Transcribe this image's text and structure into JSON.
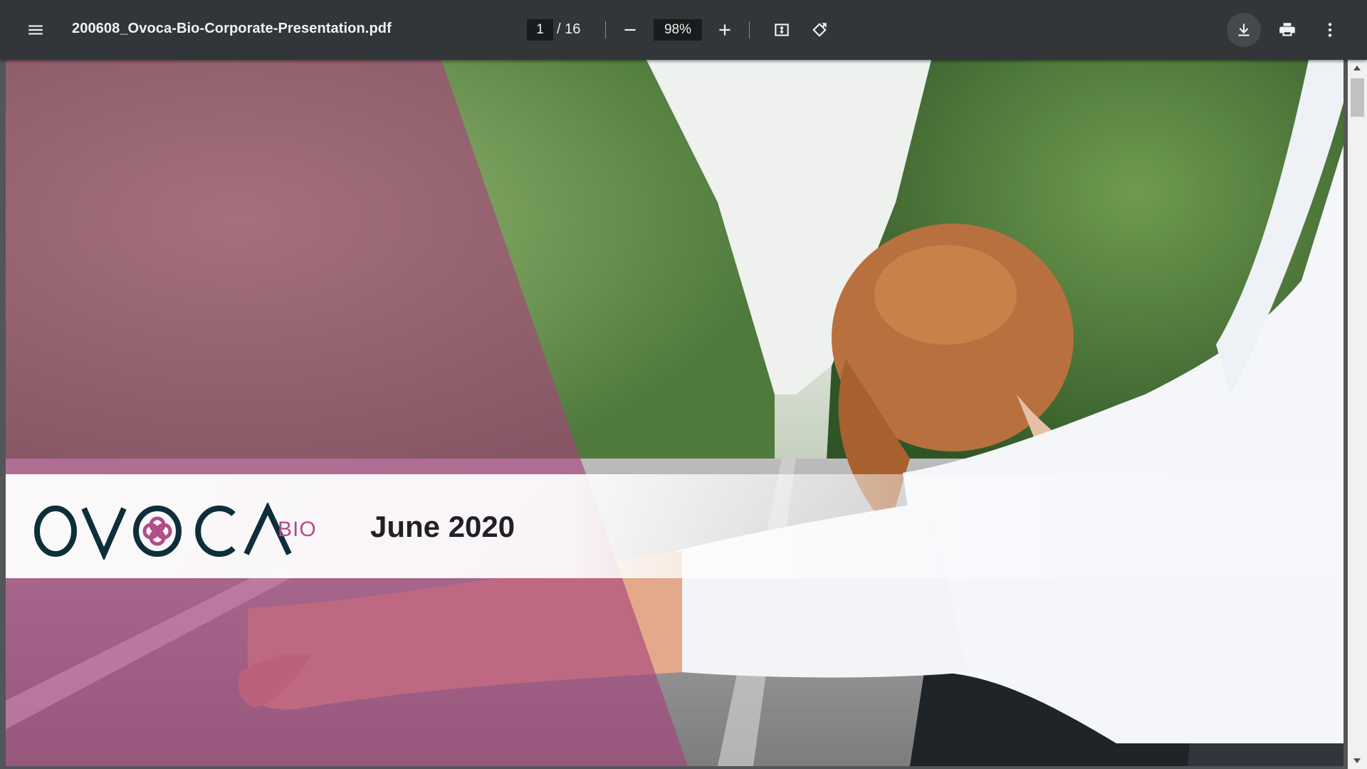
{
  "toolbar": {
    "menu_icon": "hamburger-menu-icon",
    "title": "200608_Ovoca-Bio-Corporate-Presentation.pdf",
    "page_current": "1",
    "page_separator": "/ 16",
    "zoom_value": "98%",
    "icons": [
      "zoom-out-icon",
      "zoom-in-icon",
      "fit-to-page-icon",
      "rotate-icon",
      "download-icon",
      "print-icon",
      "more-vert-icon"
    ]
  },
  "slide": {
    "logo_text": "OVOCA",
    "logo_suffix": "BIO",
    "date": "June 2020",
    "colors": {
      "overlay": "#b14d86",
      "logo_dark": "#0e2e3a",
      "logo_accent": "#b14d86"
    }
  },
  "theme": {
    "toolbar_bg": "#323639",
    "viewer_bg": "#525659",
    "scroll_track": "#f1f1f1"
  }
}
